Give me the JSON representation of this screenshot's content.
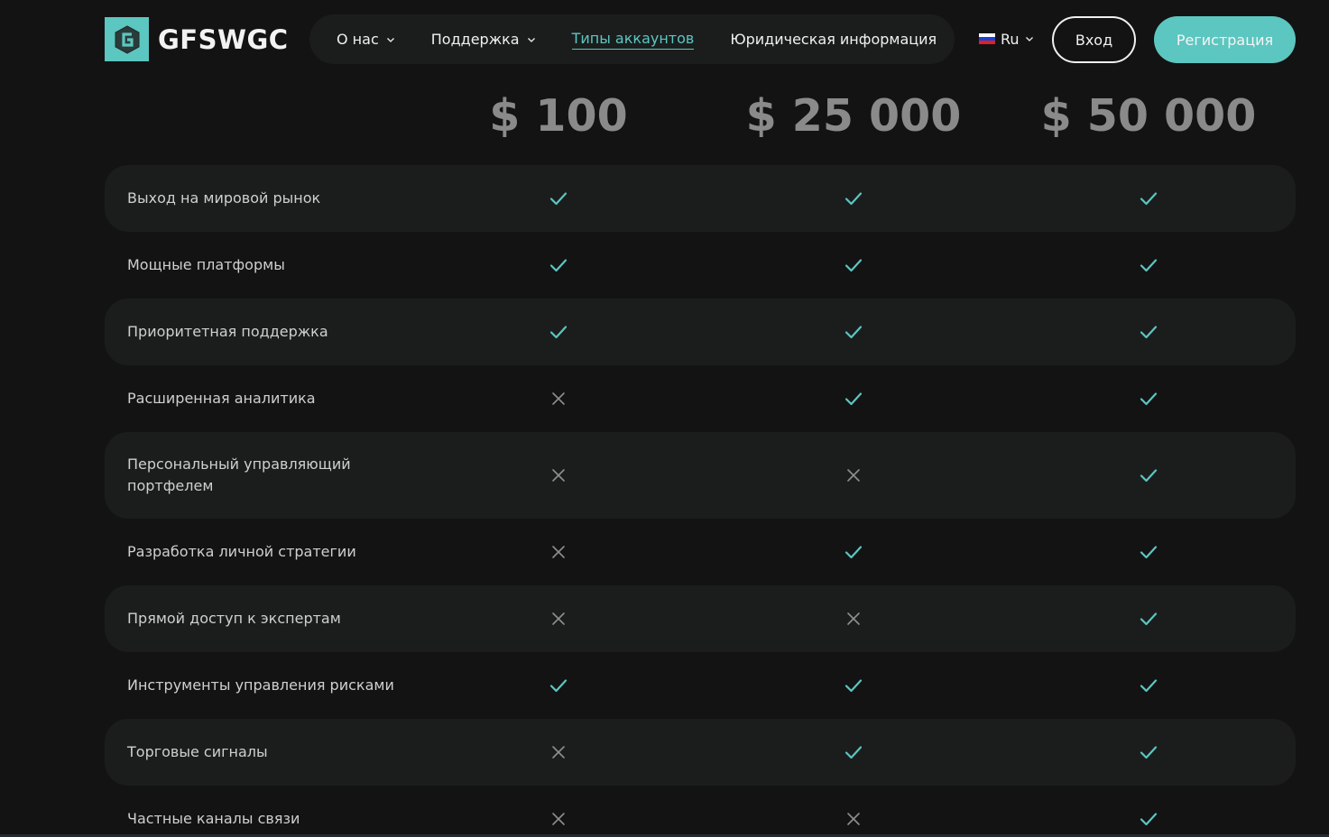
{
  "brand": {
    "name": "GFSWGC",
    "accent": "#5cc6c0"
  },
  "nav": {
    "items": [
      {
        "label": "О нас",
        "dropdown": true,
        "active": false
      },
      {
        "label": "Поддержка",
        "dropdown": true,
        "active": false
      },
      {
        "label": "Типы аккаунтов",
        "dropdown": false,
        "active": true
      },
      {
        "label": "Юридическая информация",
        "dropdown": false,
        "active": false
      }
    ]
  },
  "lang": {
    "label": "Ru",
    "icon": "russia-flag-icon"
  },
  "auth": {
    "login_label": "Вход",
    "register_label": "Регистрация"
  },
  "plans": [
    {
      "price": "$ 100"
    },
    {
      "price": "$ 25 000"
    },
    {
      "price": "$ 50 000"
    }
  ],
  "features": [
    {
      "label": "Выход на мировой рынок",
      "values": [
        true,
        true,
        true
      ]
    },
    {
      "label": "Мощные платформы",
      "values": [
        true,
        true,
        true
      ]
    },
    {
      "label": "Приоритетная поддержка",
      "values": [
        true,
        true,
        true
      ]
    },
    {
      "label": "Расширенная аналитика",
      "values": [
        false,
        true,
        true
      ]
    },
    {
      "label": "Персональный управляющий портфелем",
      "values": [
        false,
        false,
        true
      ]
    },
    {
      "label": "Разработка личной стратегии",
      "values": [
        false,
        true,
        true
      ]
    },
    {
      "label": "Прямой доступ к экспертам",
      "values": [
        false,
        false,
        true
      ]
    },
    {
      "label": "Инструменты управления рисками",
      "values": [
        true,
        true,
        true
      ]
    },
    {
      "label": "Торговые сигналы",
      "values": [
        false,
        true,
        true
      ]
    },
    {
      "label": "Частные каналы связи",
      "values": [
        false,
        false,
        true
      ]
    }
  ],
  "colors": {
    "check": "#5cc6c0",
    "cross": "#8e8e8e",
    "row_shade": "#1b1d1d",
    "background": "#131313"
  }
}
